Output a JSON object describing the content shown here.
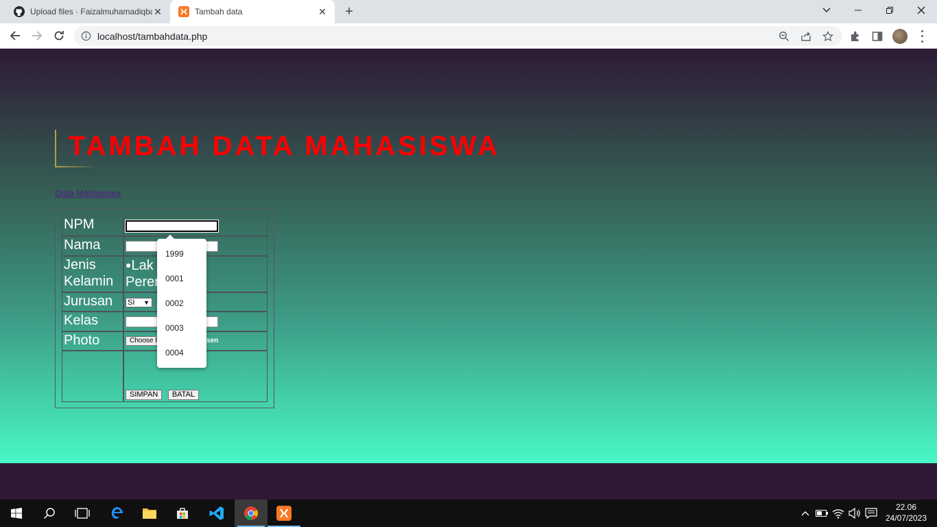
{
  "browser": {
    "tabs": [
      {
        "title": "Upload files · Faizalmuhamadiqbal",
        "active": false,
        "icon": "github-icon"
      },
      {
        "title": "Tambah data",
        "active": true,
        "icon": "xampp-icon"
      }
    ],
    "url": "localhost/tambahdata.php"
  },
  "page": {
    "heading": "TAMBAH DATA MAHASISWA",
    "nav_link": "Data Mahasiswa",
    "heading_color": "#ff0000",
    "form": {
      "npm_label": "NPM",
      "nama_label": "Nama",
      "jenis_kelamin_label_1": "Jenis",
      "jenis_kelamin_label_2": "Kelamin",
      "gender_option_1": "Lak",
      "gender_option_2": "Peren",
      "jurusan_label": "Jurusan",
      "jurusan_selected": "SI",
      "kelas_label": "Kelas",
      "photo_label": "Photo",
      "file_button": "Choose F",
      "file_status": "osen",
      "save_button": "SIMPAN",
      "cancel_button": "BATAL"
    },
    "autocomplete": [
      "1999",
      "0001",
      "0002",
      "0003",
      "0004"
    ]
  },
  "taskbar": {
    "time": "22.06",
    "date": "24/07/2023",
    "pinned": [
      "windows-start-icon",
      "search-icon",
      "task-view-icon",
      "edge-icon",
      "file-explorer-icon",
      "store-icon",
      "vscode-icon",
      "chrome-icon",
      "xampp-icon"
    ]
  }
}
